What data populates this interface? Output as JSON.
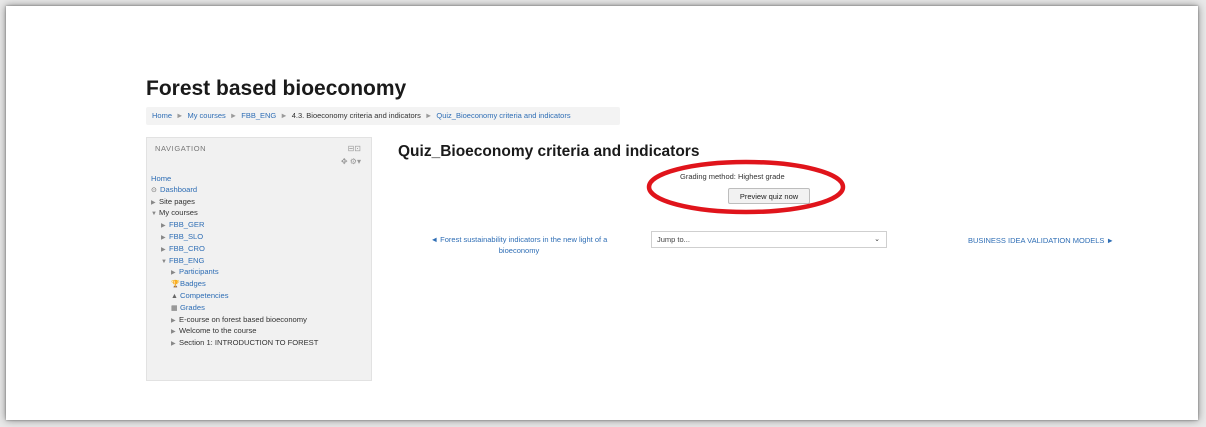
{
  "site": {
    "title": "Forest based bioeconomy"
  },
  "breadcrumb": {
    "items": [
      "Home",
      "My courses",
      "FBB_ENG",
      "4.3. Bioeconomy criteria and indicators",
      "Quiz_Bioeconomy criteria and indicators"
    ],
    "separator": "►"
  },
  "navigation": {
    "title": "NAVIGATION",
    "items": [
      {
        "label": "Home"
      },
      {
        "label": "Dashboard"
      },
      {
        "label": "Site pages"
      },
      {
        "label": "My courses"
      },
      {
        "label": "FBB_GER"
      },
      {
        "label": "FBB_SLO"
      },
      {
        "label": "FBB_CRO"
      },
      {
        "label": "FBB_ENG"
      },
      {
        "label": "Participants"
      },
      {
        "label": "Badges"
      },
      {
        "label": "Competencies"
      },
      {
        "label": "Grades"
      },
      {
        "label": "E-course on forest based bioeconomy"
      },
      {
        "label": "Welcome to the course"
      },
      {
        "label": "Section 1: INTRODUCTION TO FOREST"
      }
    ]
  },
  "quiz": {
    "title": "Quiz_Bioeconomy criteria and indicators",
    "grading_method": "Grading method: Highest grade",
    "preview_button": "Preview quiz now"
  },
  "activity_nav": {
    "prev_link": "◄ Forest sustainability indicators in the new light of a bioeconomy",
    "jump_placeholder": "Jump to...",
    "next_link": "BUSINESS IDEA VALIDATION MODELS ►"
  },
  "colors": {
    "link": "#2f6eb5",
    "annotation": "#e0141b"
  }
}
